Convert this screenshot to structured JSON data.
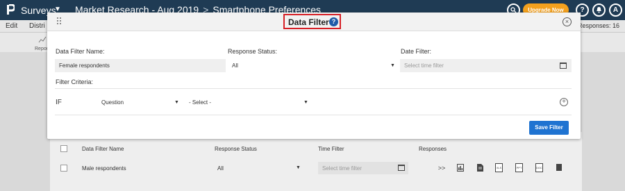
{
  "topbar": {
    "app_name": "Surveys",
    "breadcrumb_project": "Market Research - Aug 2019",
    "breadcrumb_separator": ">",
    "breadcrumb_survey": "Smartphone Preferences",
    "upgrade_label": "Upgrade Now",
    "help_label": "?",
    "avatar_label": "A",
    "search_icon": "search-icon",
    "notification_icon": "bell-icon"
  },
  "menubar": {
    "items": [
      "Edit",
      "Distri"
    ],
    "responses_count": "Responses: 16",
    "reports_tab": "Report"
  },
  "modal": {
    "title": "Data Filter",
    "help_icon": "?",
    "close_icon": "×",
    "name_label": "Data Filter Name:",
    "name_value": "Female respondents",
    "status_label": "Response Status:",
    "status_value": "All",
    "date_label": "Date Filter:",
    "date_placeholder": "Select time filter",
    "criteria_label": "Filter Criteria:",
    "if_label": "IF",
    "question_select": "Question",
    "operator_select": "- Select -",
    "add_icon": "+",
    "save_label": "Save Filter"
  },
  "table": {
    "headers": [
      "Data Filter Name",
      "Response Status",
      "Time Filter",
      "Responses"
    ],
    "rows": [
      {
        "name": "Male respondents",
        "status": "All",
        "time_placeholder": "Select time filter",
        "responses": ">>",
        "doc_icons": [
          "XLS",
          "PPT",
          "DOC"
        ]
      }
    ]
  },
  "colors": {
    "topbar": "#1f3b54",
    "upgrade": "#f4a11e",
    "primary_button": "#1f73d1",
    "highlight": "#d61f26"
  }
}
